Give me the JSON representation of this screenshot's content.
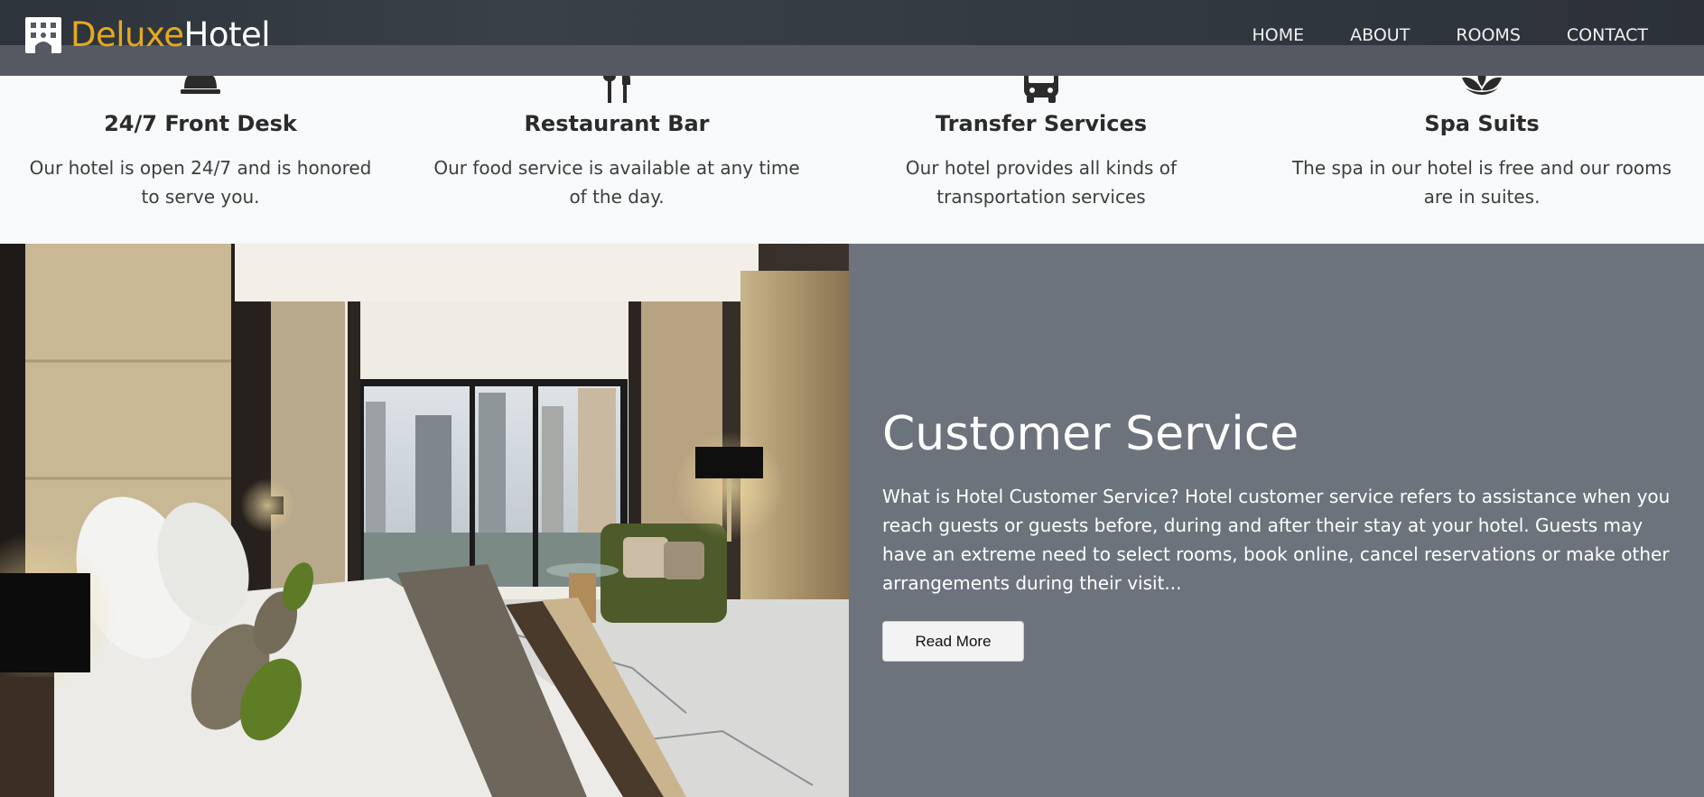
{
  "brand": {
    "part1": "Deluxe",
    "part2": "Hotel",
    "logo_icon": "hotel-building-icon"
  },
  "nav": {
    "home": "HOME",
    "about": "ABOUT",
    "rooms": "ROOMS",
    "contact": "CONTACT"
  },
  "services": [
    {
      "icon": "concierge-bell-icon",
      "title": "24/7 Front Desk",
      "text": "Our hotel is open 24/7 and is honored to serve you."
    },
    {
      "icon": "fork-knife-icon",
      "title": "Restaurant Bar",
      "text": "Our food service is available at any time of the day."
    },
    {
      "icon": "bus-icon",
      "title": "Transfer Services",
      "text": "Our hotel provides all kinds of transportation services"
    },
    {
      "icon": "spa-lotus-icon",
      "title": "Spa Suits",
      "text": "The spa in our hotel is free and our rooms are in suites."
    }
  ],
  "feature": {
    "title": "Customer Service",
    "text": "What is Hotel Customer Service? Hotel customer service refers to assistance when you reach guests or guests before, during and after their stay at your hotel. Guests may have an extreme need to select rooms, book online, cancel reservations or make other arrangements during their visit...",
    "button": "Read More"
  },
  "colors": {
    "accent": "#e6a91d",
    "header": "#545962",
    "panel": "#6c737c"
  }
}
